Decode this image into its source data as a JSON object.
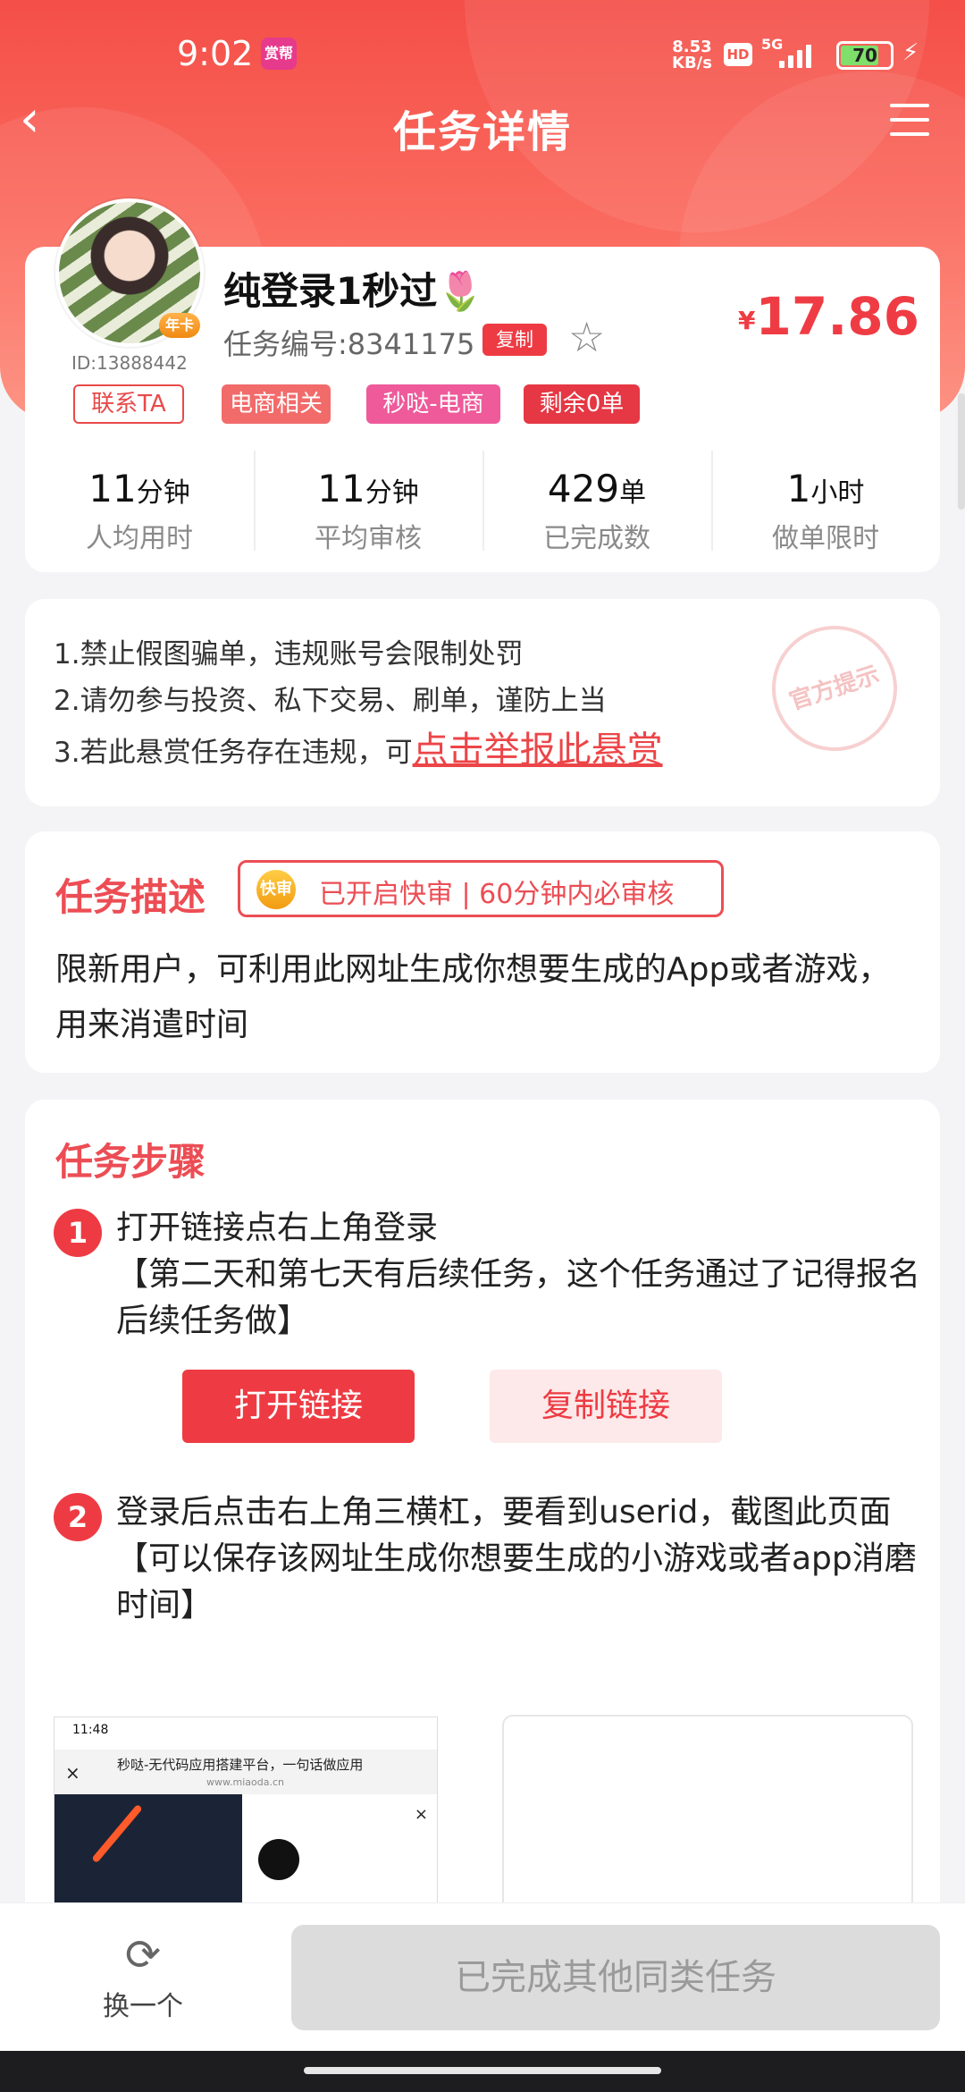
{
  "status_bar": {
    "time": "9:02",
    "app_badge": "赏帮",
    "net_speed": "8.53",
    "net_unit": "KB/s",
    "hd": "HD",
    "signal": "5G",
    "battery": "70"
  },
  "nav": {
    "title": "任务详情"
  },
  "task": {
    "title": "纯登录1秒过🌷",
    "number_label": "任务编号:8341175",
    "copy_label": "复制",
    "price_symbol": "¥",
    "price": "17.86",
    "user_id": "ID:13888442",
    "vip_badge": "年卡",
    "tags": [
      {
        "label": "联系TA",
        "style": "outline"
      },
      {
        "label": "电商相关",
        "color": "#f26b6b"
      },
      {
        "label": "秒哒-电商",
        "color": "#ee5a9a"
      },
      {
        "label": "剩余0单",
        "color": "#e53744"
      }
    ],
    "stats": [
      {
        "value": "11",
        "unit": "分钟",
        "label": "人均用时"
      },
      {
        "value": "11",
        "unit": "分钟",
        "label": "平均审核"
      },
      {
        "value": "429",
        "unit": "单",
        "label": "已完成数"
      },
      {
        "value": "1",
        "unit": "小时",
        "label": "做单限时"
      }
    ]
  },
  "notice": {
    "lines": [
      "1.禁止假图骗单，违规账号会限制处罚",
      "2.请勿参与投资、私下交易、刷单，谨防上当",
      "3.若此悬赏任务存在违规，可"
    ],
    "report_link": "点击举报此悬赏",
    "seal": "官方提示"
  },
  "description": {
    "title": "任务描述",
    "fast_coin": "快审",
    "fast_badge": "已开启快审 | 60分钟内必审核",
    "body": "限新用户，可利用此网址生成你想要生成的App或者游戏，用来消遣时间"
  },
  "steps": {
    "title": "任务步骤",
    "items": [
      {
        "num": "1",
        "text": "打开链接点右上角登录\n【第二天和第七天有后续任务，这个任务通过了记得报名后续任务做】"
      },
      {
        "num": "2",
        "text": "登录后点击右上角三横杠，要看到userid，截图此页面\n【可以保存该网址生成你想要生成的小游戏或者app消磨时间】"
      }
    ],
    "open_link": "打开链接",
    "copy_link": "复制链接",
    "screenshot": {
      "time": "11:48",
      "page_title": "秒哒-无代码应用搭建平台，一句话做应用",
      "url": "www.miaoda.cn"
    }
  },
  "bottom": {
    "swap_label": "换一个",
    "done_button": "已完成其他同类任务"
  }
}
